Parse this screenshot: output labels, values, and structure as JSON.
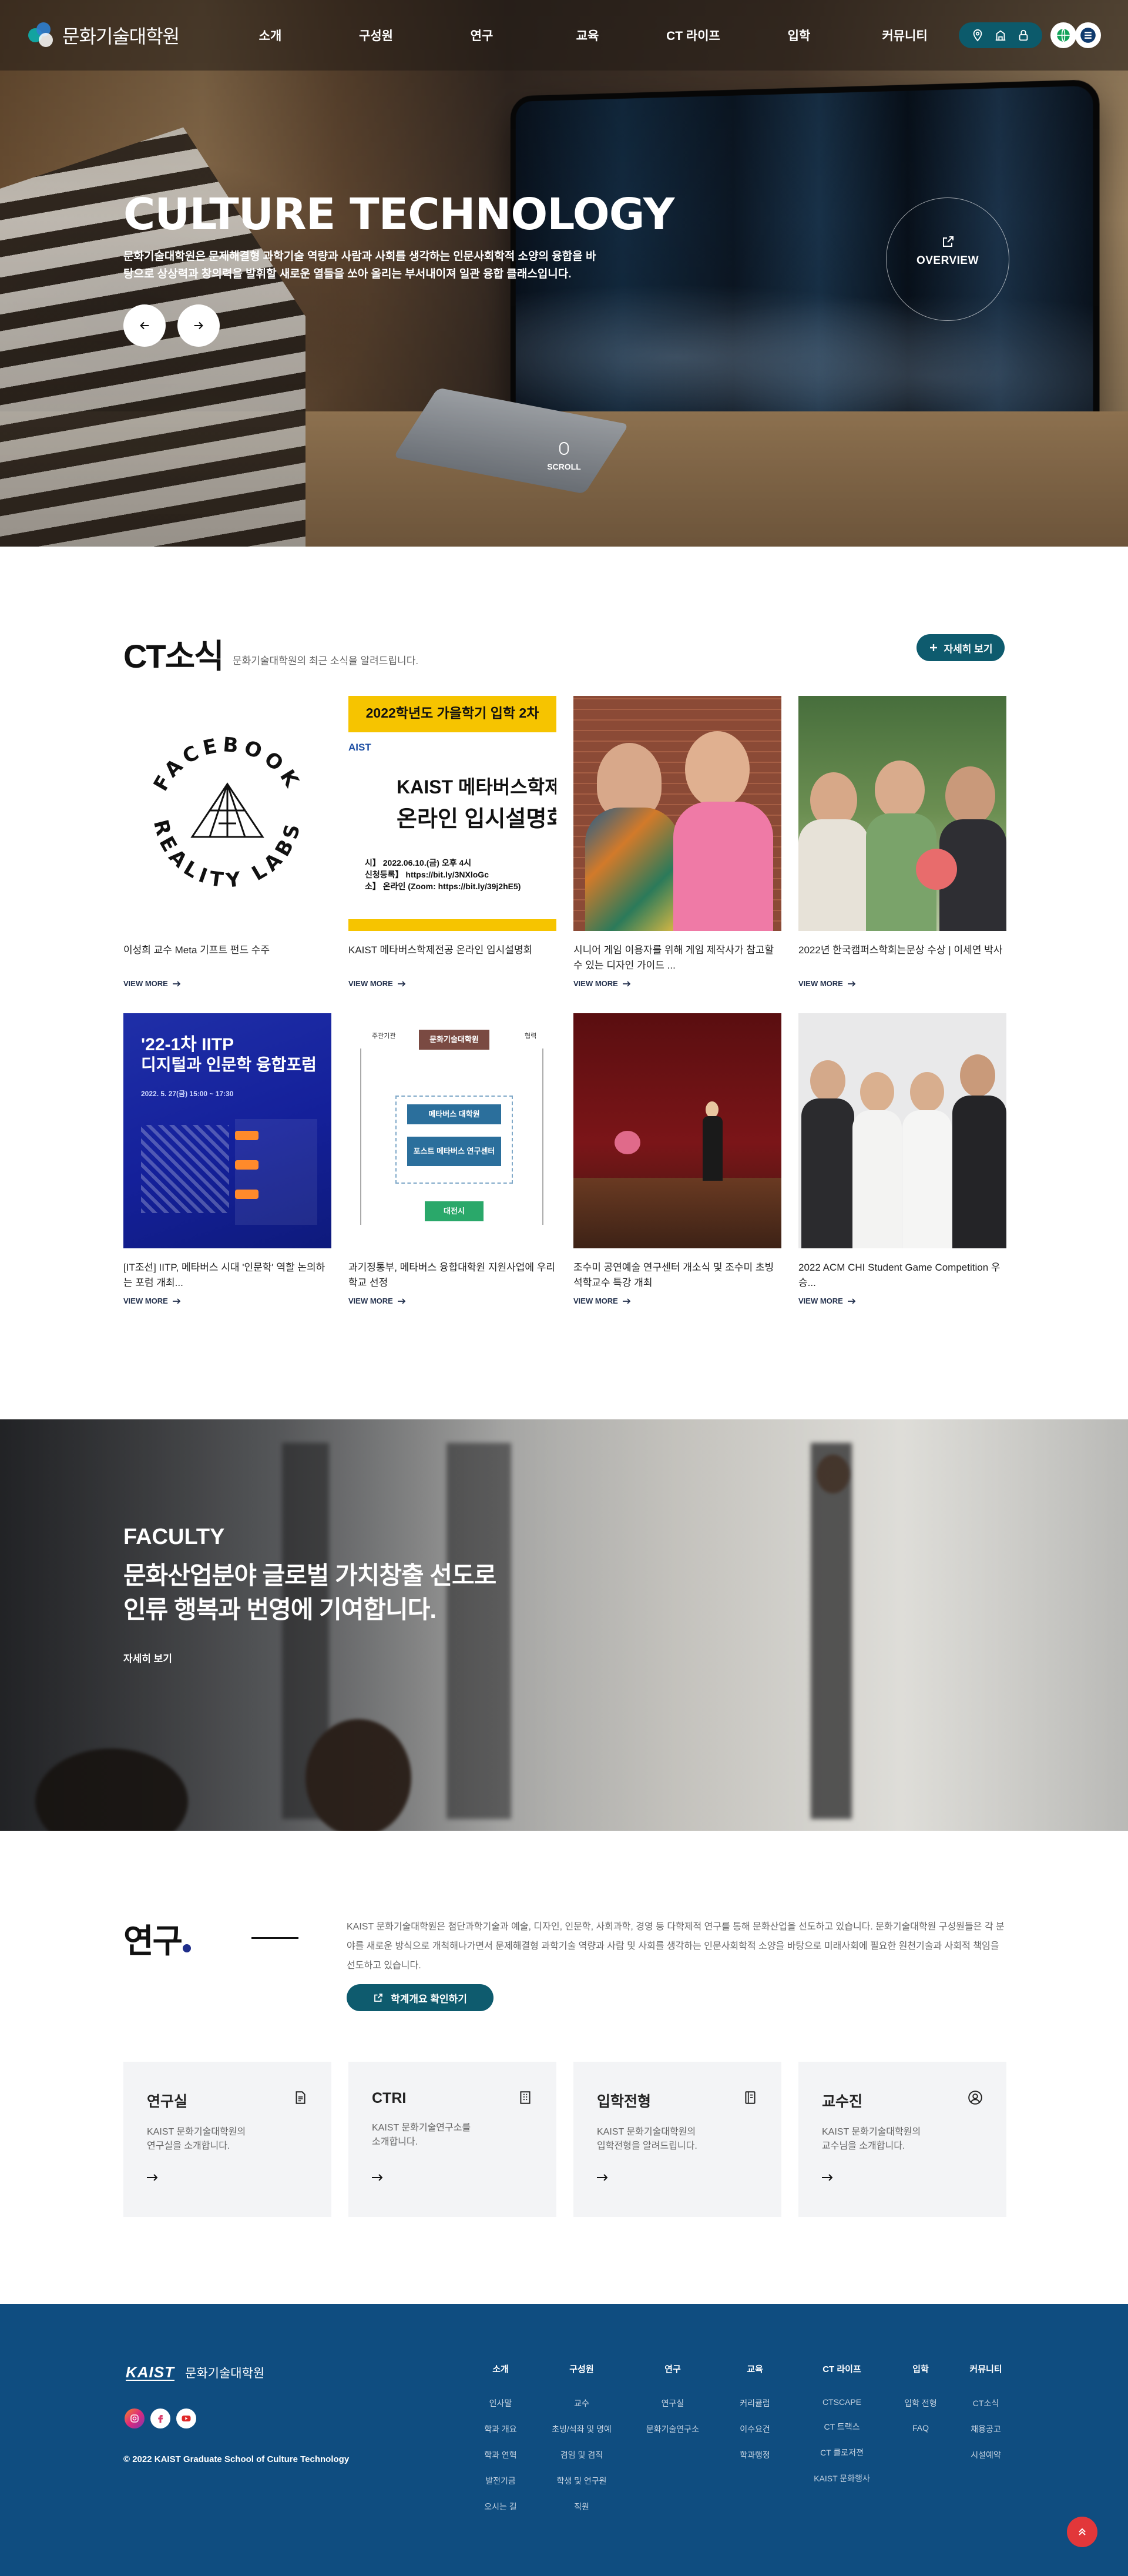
{
  "header": {
    "logo_text": "문화기술대학원",
    "nav": [
      "소개",
      "구성원",
      "연구",
      "교육",
      "CT 라이프",
      "입학",
      "커뮤니티"
    ]
  },
  "hero": {
    "title": "CULTURE TECHNOLOGY",
    "subtitle": "문화기술대학원은 문제해결형 과학기술 역량과 사람과 사회를 생각하는 인문사회학적 소양의 융합을 바탕으로 상상력과 창의력을 발휘할 새로운 열들을 쏘아 올리는 부서내이져 일관 융합 클래스입니다.",
    "overview_label": "OVERVIEW",
    "scroll_label": "SCROLL"
  },
  "news": {
    "title": "CT소식",
    "description": "문화기술대학원의 최근 소식을 알려드립니다.",
    "more_label": "자세히 보기",
    "view_more": "VIEW MORE",
    "poster1": {
      "top": "2022학년도 가을학기 입학 2차",
      "brand": "AIST",
      "line1": "KAIST 메타버스학제전",
      "line2": "온라인 입시설명회",
      "d1": "시】 2022.06.10.(금) 오후 4시",
      "d2": "신청등록】 https://bit.ly/3NXloGc",
      "d3": "소】 온라인 (Zoom: https://bit.ly/39j2hE5)"
    },
    "poster2": {
      "title1": "'22-1차 IITP",
      "title2": "디지털과 인문학 융합포럼",
      "subtitle": "디지털과 인문학 융합포럼",
      "date": "2022. 5. 27(금) 15:00 ~ 17:30"
    },
    "diagram": {
      "top": "문화기술대학원",
      "mid1": "메타버스 대학원",
      "mid2": "포스트 메타버스 연구센터",
      "bottom": "대전시",
      "left_label": "주관기관",
      "right_label": "협력"
    },
    "items": [
      {
        "title": "이성희 교수 Meta 기프트 펀드 수주"
      },
      {
        "title": "KAIST 메타버스학제전공 온라인 입시설명회"
      },
      {
        "title": "시니어 게임 이용자를 위해 게임 제작사가 참고할 수 있는 디자인 가이드 ..."
      },
      {
        "title": "2022년 한국캠퍼스학회는문상 수상 | 이세연 박사"
      },
      {
        "title": "[IT조선] IITP, 메타버스 시대 '인문학' 역할 논의하는 포럼 개최..."
      },
      {
        "title": "과기정통부, 메타버스 융합대학원 지원사업에 우리학교 선정"
      },
      {
        "title": "조수미 공연예술 연구센터 개소식 및 조수미 초빙석학교수 특강 개최"
      },
      {
        "title": "2022 ACM CHI Student Game Competition 우승..."
      }
    ],
    "facebook_text_top": "FACEBOOK",
    "facebook_text_bottom": "REALITY LABS"
  },
  "faculty": {
    "eyebrow": "FACULTY",
    "title_line1": "문화산업분야 글로벌 가치창출 선도로",
    "title_line2": "인류 행복과 번영에 기여합니다.",
    "more": "자세히 보기"
  },
  "research": {
    "title": "연구",
    "description": "KAIST 문화기술대학원은 첨단과학기술과 예술, 디자인, 인문학, 사회과학, 경영 등 다학제적 연구를 통해 문화산업을 선도하고 있습니다. 문화기술대학원 구성원들은 각 분야를 새로운 방식으로 개척해나가면서 문제해결형 과학기술 역량과 사람 및 사회를 생각하는 인문사회학적 소양을 바탕으로 미래사회에 필요한 원천기술과 사회적 책임을 선도하고 있습니다.",
    "button": "학계개요 확인하기",
    "cards": [
      {
        "title": "연구실",
        "desc": "KAIST 문화기술대학원의\n연구실을 소개합니다."
      },
      {
        "title": "CTRI",
        "desc": "KAIST 문화기술연구소를\n소개합니다."
      },
      {
        "title": "입학전형",
        "desc": "KAIST 문화기술대학원의\n입학전형을 알려드립니다."
      },
      {
        "title": "교수진",
        "desc": "KAIST 문화기술대학원의\n교수님을 소개합니다."
      }
    ]
  },
  "footer": {
    "logo_kaist": "KAIST",
    "logo_sub": "문화기술대학원",
    "copyright": "© 2022 KAIST Graduate School of Culture Technology",
    "columns": [
      {
        "title": "소개",
        "items": [
          "인사말",
          "학과 개요",
          "학과 연혁",
          "발전기금",
          "오시는 길"
        ]
      },
      {
        "title": "구성원",
        "items": [
          "교수",
          "초빙/석좌 및 명예",
          "겸임 및 겸직",
          "학생 및 연구원",
          "직원"
        ]
      },
      {
        "title": "연구",
        "items": [
          "연구실",
          "문화기술연구소"
        ]
      },
      {
        "title": "교육",
        "items": [
          "커리큘럼",
          "이수요건",
          "학과행정"
        ]
      },
      {
        "title": "CT 라이프",
        "items": [
          "CTSCAPE",
          "CT 트랙스",
          "CT 클로저젼",
          "KAIST 문화행사"
        ]
      },
      {
        "title": "입학",
        "items": [
          "입학 전형",
          "FAQ"
        ]
      },
      {
        "title": "커뮤니티",
        "items": [
          "CT소식",
          "채용공고",
          "시설예약"
        ]
      }
    ]
  },
  "colors": {
    "accent": "#0e5b6e",
    "footer": "#0f4d80",
    "top_button": "#e2373a"
  }
}
